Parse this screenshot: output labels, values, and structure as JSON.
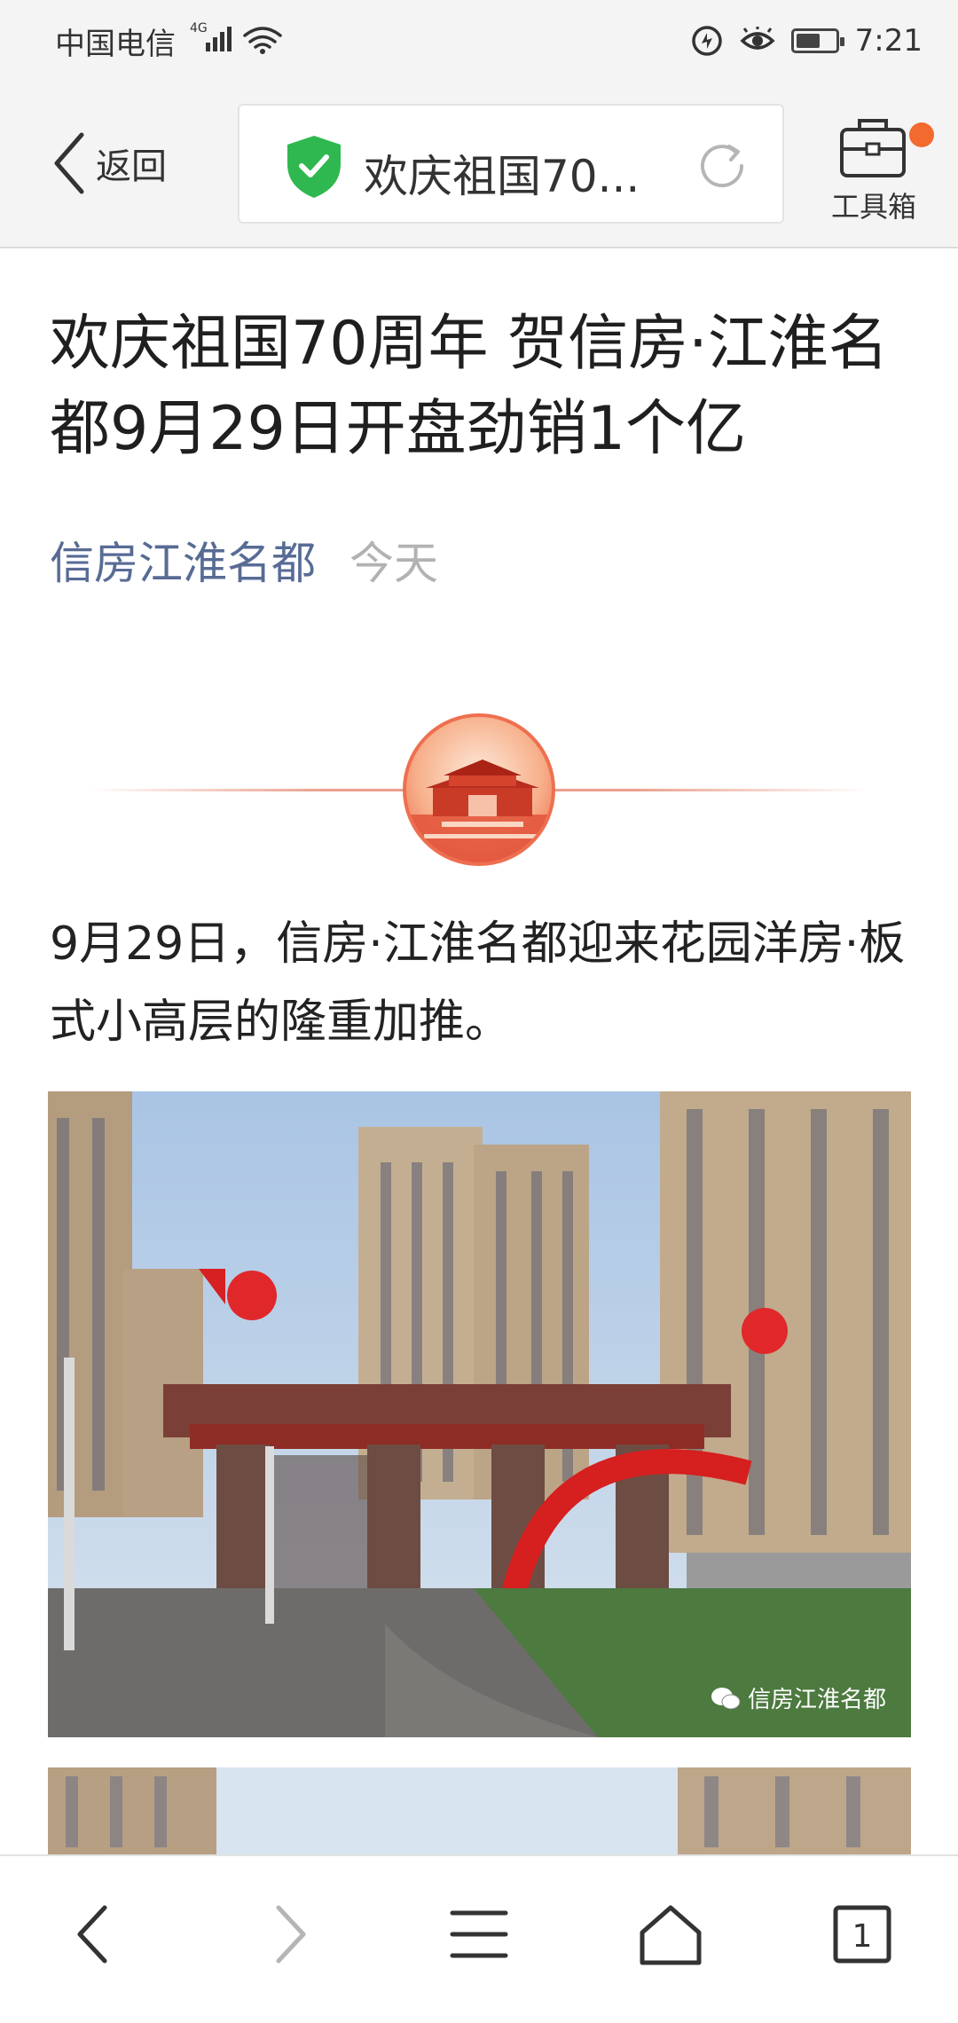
{
  "status_bar": {
    "carrier": "中国电信",
    "network": "4G",
    "time": "7:21",
    "icons": [
      "signal-icon",
      "wifi-icon",
      "data-saver-icon",
      "eye-comfort-icon",
      "battery-icon"
    ],
    "battery_level": 0.55
  },
  "header": {
    "back_label": "返回",
    "page_title": "欢庆祖国70...",
    "toolbox_label": "工具箱",
    "colors": {
      "secure": "#2fb84f",
      "badge": "#f26a2e"
    }
  },
  "article": {
    "title": "欢庆祖国70周年 贺信房·江淮名都9月29日开盘劲销1个亿",
    "author": "信房江淮名都",
    "date": "今天",
    "paragraph": "9月29日，信房·江淮名都迎来花园洋房·板式小高层的隆重加推。",
    "image_watermark": "信房江淮名都",
    "colors": {
      "author": "#576b95",
      "date": "#b2b2b2"
    }
  },
  "bottom_nav": {
    "tabs_count": "1",
    "items": [
      "back-icon",
      "forward-icon",
      "menu-icon",
      "home-icon",
      "tabs-icon"
    ]
  }
}
